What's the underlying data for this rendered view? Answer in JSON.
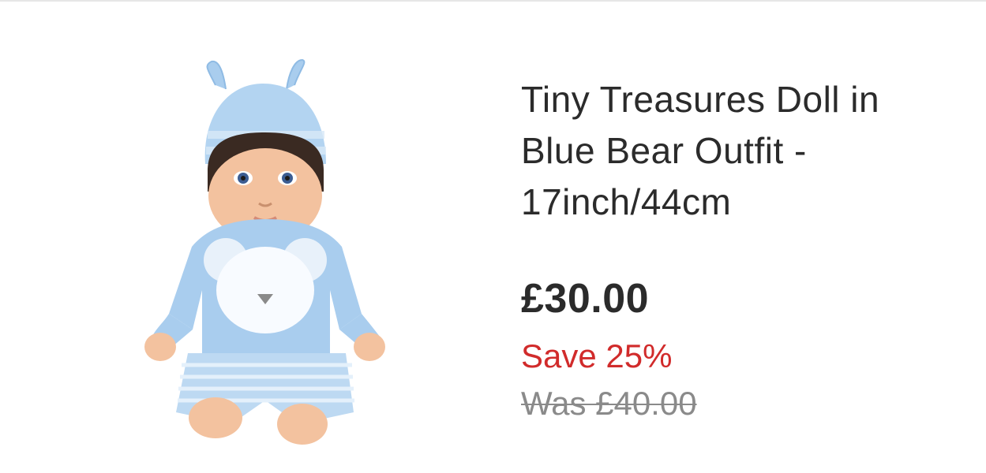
{
  "product": {
    "title": "Tiny Treasures Doll in Blue Bear Outfit - 17inch/44cm",
    "price": "£30.00",
    "save": "Save 25%",
    "was_price": "Was £40.00",
    "image_icon": "doll-product-image"
  },
  "colors": {
    "price_text": "#2b2b2b",
    "save_text": "#d12b2b",
    "was_text": "#8a8a8a",
    "outfit_blue": "#a9cdee"
  }
}
